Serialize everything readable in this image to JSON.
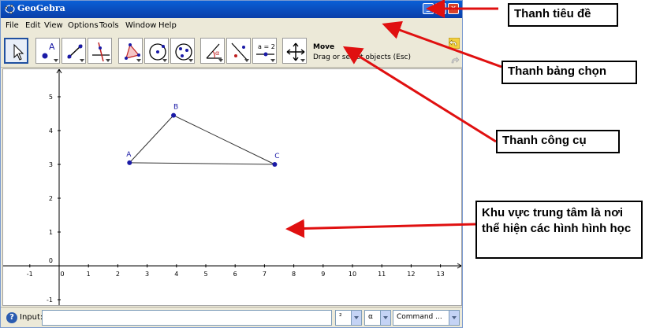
{
  "window": {
    "title": "GeoGebra"
  },
  "menu": [
    "File",
    "Edit",
    "View",
    "Options",
    "Tools",
    "Window",
    "Help"
  ],
  "toolbar": {
    "tools": [
      "move-tool",
      "point-tool",
      "line-tool",
      "perpendicular-line-tool",
      "polygon-tool",
      "circle-tool",
      "ellipse-tool",
      "angle-tool",
      "reflect-tool",
      "slider-tool",
      "move-graphics-tool"
    ],
    "slider_label": "a = 2",
    "help_title": "Move",
    "help_text": "Drag or select objects (Esc)"
  },
  "graphics": {
    "x_ticks": [
      "-1",
      "0",
      "1",
      "2",
      "3",
      "4",
      "5",
      "6",
      "7",
      "8",
      "9",
      "10",
      "11",
      "12",
      "13"
    ],
    "y_ticks": [
      "5",
      "4",
      "3",
      "2",
      "1",
      "0",
      "-1"
    ],
    "points": [
      {
        "name": "A",
        "x": 2.4,
        "y": 3.05
      },
      {
        "name": "B",
        "x": 3.9,
        "y": 4.45
      },
      {
        "name": "C",
        "x": 7.35,
        "y": 3.0
      }
    ]
  },
  "input_bar": {
    "label": "Input:",
    "value": "",
    "symbols_value": "²",
    "greek_value": "α",
    "command_value": "Command ..."
  },
  "annotations": [
    "Thanh tiêu đề",
    "Thanh bảng chọn",
    "Thanh công cụ",
    "Khu vực trung tâm là nơi thể hiện các hình hình học"
  ],
  "colors": {
    "point": "#1a1aa6",
    "titlebar": "#0a4fc8",
    "arrow": "#e01010"
  }
}
